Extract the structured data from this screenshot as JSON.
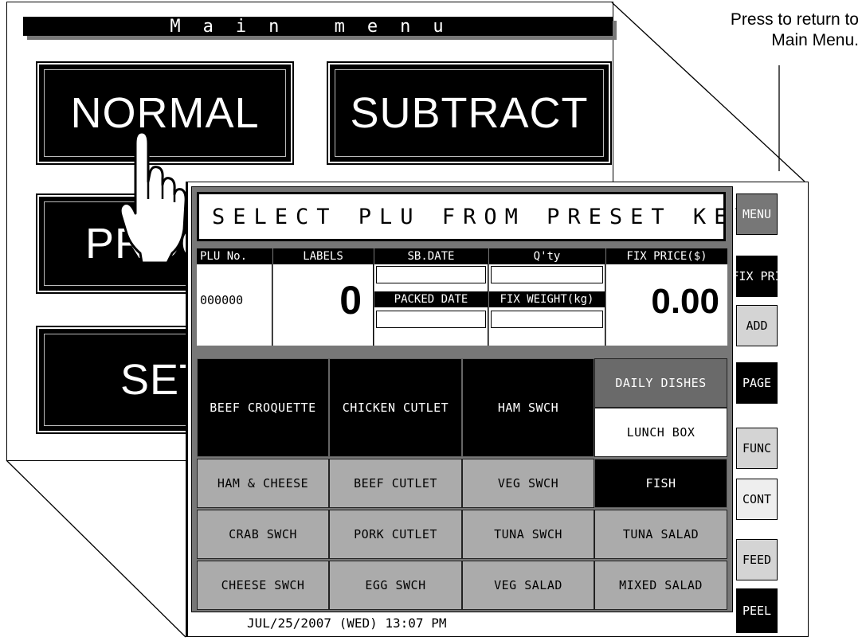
{
  "annotation": {
    "caption_line1": "Press to return to",
    "caption_line2": "Main Menu."
  },
  "main_menu": {
    "title": "Main menu",
    "buttons": {
      "normal": "NORMAL",
      "subtract": "SUBTRACT",
      "prog": "PROG",
      "set": "SET"
    }
  },
  "plu_screen": {
    "prompt": "SELECT PLU FROM PRESET KEY",
    "info": {
      "plu_no_label": "PLU No.",
      "plu_no_value": "000000",
      "labels_label": "LABELS",
      "labels_value": "0",
      "sb_date_label": "SB.DATE",
      "packed_date_label": "PACKED DATE",
      "qty_label": "Q'ty",
      "fix_weight_label": "FIX WEIGHT(kg)",
      "fix_price_label": "FIX PRICE($)",
      "fix_price_value": "0.00"
    },
    "keys": {
      "beef_croquette": "BEEF CROQUETTE",
      "chicken_cutlet": "CHICKEN CUTLET",
      "ham_swch": "HAM SWCH",
      "daily_dishes": "DAILY DISHES",
      "lunch_box": "LUNCH BOX",
      "ham_cheese": "HAM & CHEESE",
      "beef_cutlet": "BEEF CUTLET",
      "veg_swch": "VEG SWCH",
      "fish": "FISH",
      "crab_swch": "CRAB SWCH",
      "pork_cutlet": "PORK CUTLET",
      "tuna_swch": "TUNA SWCH",
      "tuna_salad": "TUNA SALAD",
      "cheese_swch": "CHEESE SWCH",
      "egg_swch": "EGG SWCH",
      "veg_salad": "VEG SALAD",
      "mixed_salad": "MIXED SALAD"
    },
    "side": {
      "menu": "MENU",
      "fix_pri": "FIX PRI",
      "add": "ADD",
      "page": "PAGE",
      "func": "FUNC",
      "cont": "CONT",
      "feed": "FEED",
      "peel": "PEEL"
    },
    "datetime": "JUL/25/2007 (WED)  13:07 PM"
  },
  "icons": [
    "pointing-hand-icon"
  ]
}
